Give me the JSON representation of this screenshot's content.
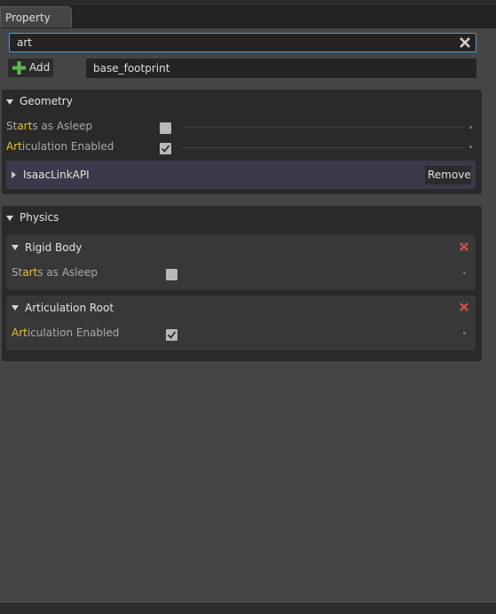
{
  "tab": {
    "label": "Property"
  },
  "search": {
    "value": "art"
  },
  "add_button": {
    "label": "Add"
  },
  "prim_path": {
    "value": "base_footprint"
  },
  "geometry": {
    "title": "Geometry",
    "rows": [
      {
        "label_pre": "St",
        "label_hl": "art",
        "label_post": "s as Asleep",
        "checked": false
      },
      {
        "label_pre": "",
        "label_hl": "Art",
        "label_post": "iculation Enabled",
        "checked": true
      }
    ],
    "isaac": {
      "title": "IsaacLinkAPI",
      "remove_label": "Remove"
    }
  },
  "physics": {
    "title": "Physics",
    "rigid_body": {
      "title": "Rigid Body",
      "row": {
        "label_pre": "St",
        "label_hl": "art",
        "label_post": "s as Asleep",
        "checked": false
      }
    },
    "articulation_root": {
      "title": "Articulation Root",
      "row": {
        "label_pre": "",
        "label_hl": "Art",
        "label_post": "iculation Enabled",
        "checked": true
      }
    }
  },
  "colors": {
    "highlight": "#e6c32a",
    "search_border": "#4f9cd6",
    "add_green": "#5fb84f",
    "delete_red": "#d24a4a"
  }
}
